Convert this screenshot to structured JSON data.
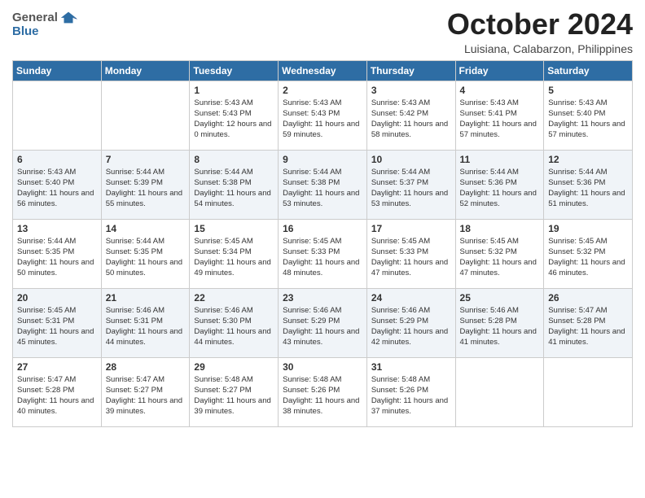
{
  "header": {
    "logo_general": "General",
    "logo_blue": "Blue",
    "month_title": "October 2024",
    "location": "Luisiana, Calabarzon, Philippines"
  },
  "weekdays": [
    "Sunday",
    "Monday",
    "Tuesday",
    "Wednesday",
    "Thursday",
    "Friday",
    "Saturday"
  ],
  "weeks": [
    [
      {
        "day": "",
        "sunrise": "",
        "sunset": "",
        "daylight": ""
      },
      {
        "day": "",
        "sunrise": "",
        "sunset": "",
        "daylight": ""
      },
      {
        "day": "1",
        "sunrise": "Sunrise: 5:43 AM",
        "sunset": "Sunset: 5:43 PM",
        "daylight": "Daylight: 12 hours and 0 minutes."
      },
      {
        "day": "2",
        "sunrise": "Sunrise: 5:43 AM",
        "sunset": "Sunset: 5:43 PM",
        "daylight": "Daylight: 11 hours and 59 minutes."
      },
      {
        "day": "3",
        "sunrise": "Sunrise: 5:43 AM",
        "sunset": "Sunset: 5:42 PM",
        "daylight": "Daylight: 11 hours and 58 minutes."
      },
      {
        "day": "4",
        "sunrise": "Sunrise: 5:43 AM",
        "sunset": "Sunset: 5:41 PM",
        "daylight": "Daylight: 11 hours and 57 minutes."
      },
      {
        "day": "5",
        "sunrise": "Sunrise: 5:43 AM",
        "sunset": "Sunset: 5:40 PM",
        "daylight": "Daylight: 11 hours and 57 minutes."
      }
    ],
    [
      {
        "day": "6",
        "sunrise": "Sunrise: 5:43 AM",
        "sunset": "Sunset: 5:40 PM",
        "daylight": "Daylight: 11 hours and 56 minutes."
      },
      {
        "day": "7",
        "sunrise": "Sunrise: 5:44 AM",
        "sunset": "Sunset: 5:39 PM",
        "daylight": "Daylight: 11 hours and 55 minutes."
      },
      {
        "day": "8",
        "sunrise": "Sunrise: 5:44 AM",
        "sunset": "Sunset: 5:38 PM",
        "daylight": "Daylight: 11 hours and 54 minutes."
      },
      {
        "day": "9",
        "sunrise": "Sunrise: 5:44 AM",
        "sunset": "Sunset: 5:38 PM",
        "daylight": "Daylight: 11 hours and 53 minutes."
      },
      {
        "day": "10",
        "sunrise": "Sunrise: 5:44 AM",
        "sunset": "Sunset: 5:37 PM",
        "daylight": "Daylight: 11 hours and 53 minutes."
      },
      {
        "day": "11",
        "sunrise": "Sunrise: 5:44 AM",
        "sunset": "Sunset: 5:36 PM",
        "daylight": "Daylight: 11 hours and 52 minutes."
      },
      {
        "day": "12",
        "sunrise": "Sunrise: 5:44 AM",
        "sunset": "Sunset: 5:36 PM",
        "daylight": "Daylight: 11 hours and 51 minutes."
      }
    ],
    [
      {
        "day": "13",
        "sunrise": "Sunrise: 5:44 AM",
        "sunset": "Sunset: 5:35 PM",
        "daylight": "Daylight: 11 hours and 50 minutes."
      },
      {
        "day": "14",
        "sunrise": "Sunrise: 5:44 AM",
        "sunset": "Sunset: 5:35 PM",
        "daylight": "Daylight: 11 hours and 50 minutes."
      },
      {
        "day": "15",
        "sunrise": "Sunrise: 5:45 AM",
        "sunset": "Sunset: 5:34 PM",
        "daylight": "Daylight: 11 hours and 49 minutes."
      },
      {
        "day": "16",
        "sunrise": "Sunrise: 5:45 AM",
        "sunset": "Sunset: 5:33 PM",
        "daylight": "Daylight: 11 hours and 48 minutes."
      },
      {
        "day": "17",
        "sunrise": "Sunrise: 5:45 AM",
        "sunset": "Sunset: 5:33 PM",
        "daylight": "Daylight: 11 hours and 47 minutes."
      },
      {
        "day": "18",
        "sunrise": "Sunrise: 5:45 AM",
        "sunset": "Sunset: 5:32 PM",
        "daylight": "Daylight: 11 hours and 47 minutes."
      },
      {
        "day": "19",
        "sunrise": "Sunrise: 5:45 AM",
        "sunset": "Sunset: 5:32 PM",
        "daylight": "Daylight: 11 hours and 46 minutes."
      }
    ],
    [
      {
        "day": "20",
        "sunrise": "Sunrise: 5:45 AM",
        "sunset": "Sunset: 5:31 PM",
        "daylight": "Daylight: 11 hours and 45 minutes."
      },
      {
        "day": "21",
        "sunrise": "Sunrise: 5:46 AM",
        "sunset": "Sunset: 5:31 PM",
        "daylight": "Daylight: 11 hours and 44 minutes."
      },
      {
        "day": "22",
        "sunrise": "Sunrise: 5:46 AM",
        "sunset": "Sunset: 5:30 PM",
        "daylight": "Daylight: 11 hours and 44 minutes."
      },
      {
        "day": "23",
        "sunrise": "Sunrise: 5:46 AM",
        "sunset": "Sunset: 5:29 PM",
        "daylight": "Daylight: 11 hours and 43 minutes."
      },
      {
        "day": "24",
        "sunrise": "Sunrise: 5:46 AM",
        "sunset": "Sunset: 5:29 PM",
        "daylight": "Daylight: 11 hours and 42 minutes."
      },
      {
        "day": "25",
        "sunrise": "Sunrise: 5:46 AM",
        "sunset": "Sunset: 5:28 PM",
        "daylight": "Daylight: 11 hours and 41 minutes."
      },
      {
        "day": "26",
        "sunrise": "Sunrise: 5:47 AM",
        "sunset": "Sunset: 5:28 PM",
        "daylight": "Daylight: 11 hours and 41 minutes."
      }
    ],
    [
      {
        "day": "27",
        "sunrise": "Sunrise: 5:47 AM",
        "sunset": "Sunset: 5:28 PM",
        "daylight": "Daylight: 11 hours and 40 minutes."
      },
      {
        "day": "28",
        "sunrise": "Sunrise: 5:47 AM",
        "sunset": "Sunset: 5:27 PM",
        "daylight": "Daylight: 11 hours and 39 minutes."
      },
      {
        "day": "29",
        "sunrise": "Sunrise: 5:48 AM",
        "sunset": "Sunset: 5:27 PM",
        "daylight": "Daylight: 11 hours and 39 minutes."
      },
      {
        "day": "30",
        "sunrise": "Sunrise: 5:48 AM",
        "sunset": "Sunset: 5:26 PM",
        "daylight": "Daylight: 11 hours and 38 minutes."
      },
      {
        "day": "31",
        "sunrise": "Sunrise: 5:48 AM",
        "sunset": "Sunset: 5:26 PM",
        "daylight": "Daylight: 11 hours and 37 minutes."
      },
      {
        "day": "",
        "sunrise": "",
        "sunset": "",
        "daylight": ""
      },
      {
        "day": "",
        "sunrise": "",
        "sunset": "",
        "daylight": ""
      }
    ]
  ]
}
